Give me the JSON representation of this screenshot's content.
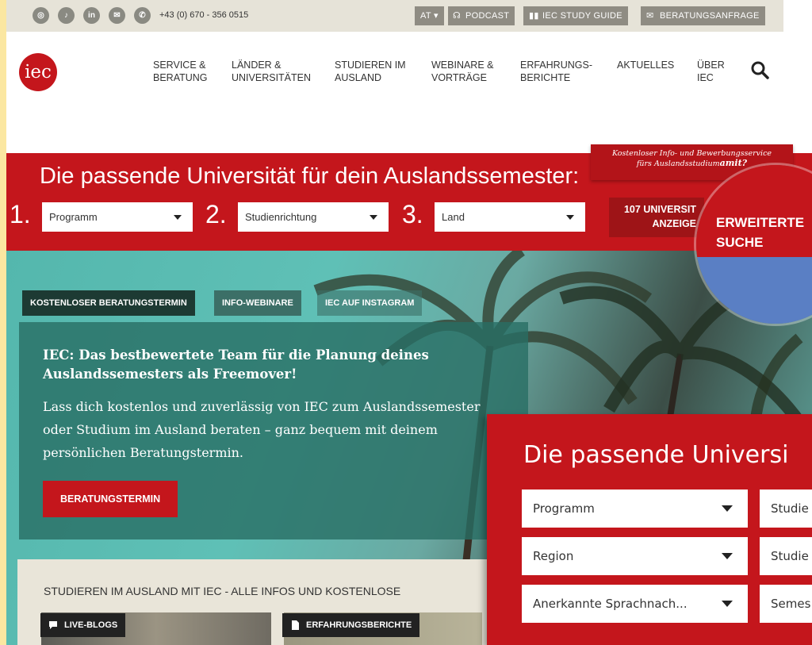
{
  "topbar": {
    "social_icons": [
      "instagram-icon",
      "tiktok-icon",
      "linkedin-icon",
      "mail-icon",
      "phone-icon"
    ],
    "social_glyphs": [
      "◎",
      "♪",
      "in",
      "✉",
      "✆"
    ],
    "phone": "+43 (0) 670 - 356 0515",
    "lang": "AT ▾",
    "podcast": "PODCAST",
    "study_guide": "IEC STUDY GUIDE",
    "inquiry": "BERATUNGSANFRAGE"
  },
  "header": {
    "logo": "iec",
    "nav": [
      {
        "line1": "SERVICE &",
        "line2": "BERATUNG"
      },
      {
        "line1": "LÄNDER &",
        "line2": "UNIVERSITÄTEN"
      },
      {
        "line1": "STUDIEREN IM",
        "line2": "AUSLAND"
      },
      {
        "line1": "WEBINARE &",
        "line2": "VORTRÄGE"
      },
      {
        "line1": "ERFAHRUNGS-",
        "line2": "BERICHTE"
      },
      {
        "line1": "AKTUELLES",
        "line2": ""
      },
      {
        "line1": "ÜBER",
        "line2": "IEC"
      }
    ]
  },
  "finder": {
    "title": "Die passende Universität für dein Auslandssemester:",
    "step1": "1.",
    "step2": "2.",
    "step3": "3.",
    "program": "Programm",
    "field": "Studienrichtung",
    "country": "Land",
    "count_line1": "107 UNIVERSIT",
    "count_line2": "ANZEIGE",
    "promo_line1": "Kostenloser Info- und Bewerbungsservice",
    "promo_line2": "fürs Auslandsstudium",
    "promo_tail": "amit?",
    "advanced_line1": "ERWEITERTE",
    "advanced_line2": "SUCHE"
  },
  "tabs": [
    "KOSTENLOSER BERATUNGSTERMIN",
    "INFO-WEBINARE",
    "IEC AUF INSTAGRAM"
  ],
  "card": {
    "title": "IEC: Das bestbewertete Team für die Planung deines Auslandssemesters als Freemover!",
    "body": "Lass dich kostenlos und zuverlässig von IEC zum Auslandssemester oder Studium im Ausland beraten – ganz bequem mit deinem persönlichen Beratungstermin.",
    "button": "BERATUNGSTERMIN"
  },
  "info": {
    "heading": "STUDIEREN IM AUSLAND MIT IEC - ALLE INFOS UND KOSTENLOSE",
    "tag1": "LIVE-BLOGS",
    "tag2": "ERFAHRUNGSBERICHTE"
  },
  "zoom": {
    "title": "Die passende Universi",
    "fields": [
      "Programm",
      "Region",
      "Anerkannte Sprachnach..."
    ],
    "fields_right": [
      "Studie",
      "Studie",
      "Semes"
    ]
  },
  "colors": {
    "brand_red": "#c4161c",
    "teal": "#5fc0b6",
    "topbar": "#e6e3d8"
  }
}
